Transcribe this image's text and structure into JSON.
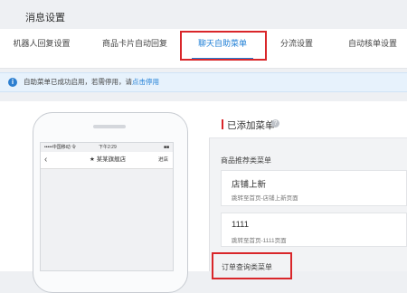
{
  "page": {
    "title": "消息设置"
  },
  "tabs": [
    {
      "label": "机器人回复设置"
    },
    {
      "label": "商品卡片自动回复"
    },
    {
      "label": "聊天自助菜单"
    },
    {
      "label": "分流设置"
    },
    {
      "label": "自动核单设置"
    }
  ],
  "info": {
    "text": "自助菜单已成功启用，若需停用，请",
    "link": "点击停用"
  },
  "phone": {
    "carrier": "•••••中国移动 令",
    "time": "下午2:29",
    "battery": "■■",
    "back_icon": "chevron-left-icon",
    "shop_name": "★ 某某旗舰店",
    "shop_link": "进店"
  },
  "panel": {
    "title": "已添加菜单",
    "categories": [
      {
        "title": "商品推荐类菜单",
        "items": [
          {
            "title": "店铺上新",
            "subtitle": "跳转至首页-店铺上新页面"
          },
          {
            "title": "1111",
            "subtitle": "跳转至首页-1111页面"
          }
        ]
      },
      {
        "title": "订单查询类菜单"
      }
    ]
  },
  "colors": {
    "accent": "#1f7fd6",
    "highlight": "#d9262a"
  }
}
